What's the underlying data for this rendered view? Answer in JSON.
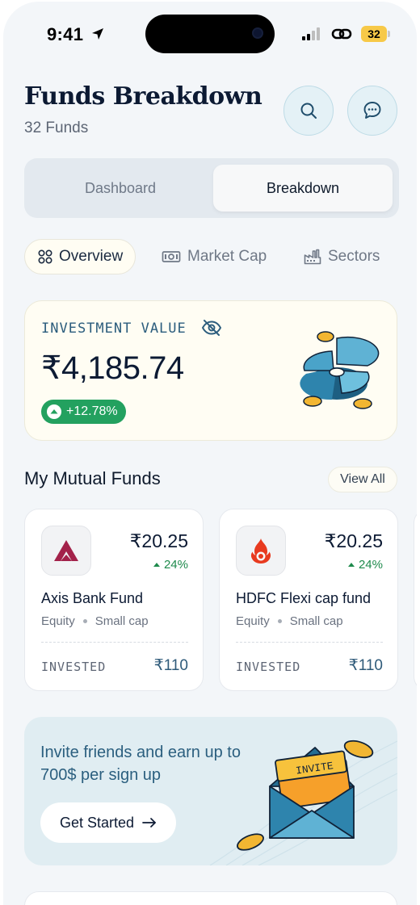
{
  "status_bar": {
    "time": "9:41",
    "battery": "32"
  },
  "header": {
    "title": "Funds Breakdown",
    "subtitle": "32 Funds"
  },
  "segmented": {
    "dashboard": "Dashboard",
    "breakdown": "Breakdown",
    "selected": "Breakdown"
  },
  "chips": [
    {
      "label": "Overview",
      "icon": "grid-icon"
    },
    {
      "label": "Market Cap",
      "icon": "banknote-icon"
    },
    {
      "label": "Sectors",
      "icon": "factory-icon"
    }
  ],
  "investment": {
    "label": "INVESTMENT VALUE",
    "value": "₹4,185.74",
    "change": "+12.78%"
  },
  "mutual_funds": {
    "title": "My Mutual Funds",
    "view_all": "View All",
    "funds": [
      {
        "name": "Axis Bank Fund",
        "price": "₹20.25",
        "change": "24%",
        "category": "Equity",
        "cap": "Small cap",
        "invested_label": "INVESTED",
        "invested": "₹110"
      },
      {
        "name": "HDFC Flexi cap fund",
        "price": "₹20.25",
        "change": "24%",
        "category": "Equity",
        "cap": "Small cap",
        "invested_label": "INVESTED",
        "invested": "₹110"
      }
    ]
  },
  "invite": {
    "text": "Invite friends and earn  up to 700$ per sign up",
    "button": "Get Started",
    "envelope_label": "INVITE"
  },
  "colors": {
    "accent": "#2b5f7f",
    "positive": "#23a15f",
    "card_cream": "#fffdf3",
    "background": "#f3f6f9"
  }
}
